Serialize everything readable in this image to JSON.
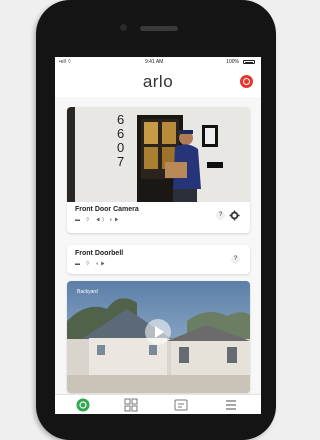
{
  "status_bar": {
    "carrier": "•ııll ⌔",
    "time": "9:41 AM",
    "battery": "100%"
  },
  "header": {
    "logo_text": "arlo",
    "notification_icon": "alert-icon"
  },
  "devices": [
    {
      "name": "Front Door Camera",
      "status_icons": "▬ ⌔ ◀) ◖▶",
      "info_label": "?",
      "settings_icon": "gear-icon"
    },
    {
      "name": "Front Doorbell",
      "status_icons": "▬ ⌔ ◖▶",
      "info_label": "?"
    },
    {
      "name": "Backyard",
      "label_on_feed": "Backyard",
      "play_icon": "play-icon"
    }
  ],
  "scene": {
    "house_number": [
      "6",
      "6",
      "0",
      "7"
    ]
  },
  "tab_bar": {
    "items": [
      "devices-icon",
      "library-icon",
      "modes-icon",
      "settings-icon"
    ]
  },
  "colors": {
    "accent_green": "#2fa84f",
    "alert_red": "#e5352e",
    "phone_body": "#141414"
  }
}
